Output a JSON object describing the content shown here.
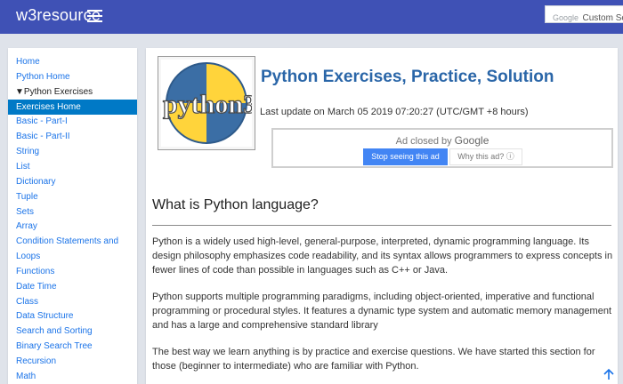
{
  "header": {
    "brand": "w3resource",
    "search_brand": "Google",
    "search_placeholder": "Custom Se"
  },
  "sidebar": {
    "items": [
      {
        "label": "Home",
        "name": "sidebar-item-home"
      },
      {
        "label": "Python Home",
        "name": "sidebar-item-python-home"
      },
      {
        "label": "▼Python Exercises",
        "name": "sidebar-item-python-exercises"
      },
      {
        "label": "Exercises Home",
        "name": "sidebar-item-exercises-home"
      },
      {
        "label": "Basic - Part-I",
        "name": "sidebar-item-basic-part-1"
      },
      {
        "label": "Basic - Part-II",
        "name": "sidebar-item-basic-part-2"
      },
      {
        "label": "String",
        "name": "sidebar-item-string"
      },
      {
        "label": "List",
        "name": "sidebar-item-list"
      },
      {
        "label": "Dictionary",
        "name": "sidebar-item-dictionary"
      },
      {
        "label": "Tuple",
        "name": "sidebar-item-tuple"
      },
      {
        "label": "Sets",
        "name": "sidebar-item-sets"
      },
      {
        "label": "Array",
        "name": "sidebar-item-array"
      },
      {
        "label": "Condition Statements and",
        "name": "sidebar-item-condition-statements"
      },
      {
        "label": "Loops",
        "name": "sidebar-item-loops"
      },
      {
        "label": "Functions",
        "name": "sidebar-item-functions"
      },
      {
        "label": "Date Time",
        "name": "sidebar-item-date-time"
      },
      {
        "label": "Class",
        "name": "sidebar-item-class"
      },
      {
        "label": "Data Structure",
        "name": "sidebar-item-data-structure"
      },
      {
        "label": "Search and Sorting",
        "name": "sidebar-item-search-sorting"
      },
      {
        "label": "Binary Search Tree",
        "name": "sidebar-item-binary-search-tree"
      },
      {
        "label": "Recursion",
        "name": "sidebar-item-recursion"
      },
      {
        "label": "Math",
        "name": "sidebar-item-math"
      }
    ],
    "active_label": "Exercises Home",
    "expanded_group": "▼Python Exercises"
  },
  "main": {
    "logo_text": "python3",
    "title": "Python Exercises, Practice, Solution",
    "last_update": "Last update on March 05 2019 07:20:27 (UTC/GMT +8 hours)",
    "ad": {
      "closed_by": "Ad closed by",
      "closed_by_brand": "Google",
      "stop_button": "Stop seeing this ad",
      "why_button": "Why this ad?",
      "why_icon": "info-icon"
    },
    "section_heading": "What is Python language?",
    "paragraphs": [
      "Python is a widely used high-level, general-purpose, interpreted, dynamic programming language. Its design philosophy emphasizes code readability, and its syntax allows programmers to express concepts in fewer lines of code than possible in languages such as C++ or Java.",
      "Python supports multiple programming paradigms, including object-oriented, imperative and functional programming or procedural styles. It features a dynamic type system and automatic memory management and has a large and comprehensive standard library",
      "The best way we learn anything is by practice and exercise questions. We have started this section for those (beginner to intermediate) who are familiar with Python."
    ]
  },
  "colors": {
    "header_bg": "#3f51b5",
    "link": "#1a73e8",
    "active_bg": "#0079c6",
    "title": "#2a66a8",
    "ad_button": "#4285f4"
  }
}
